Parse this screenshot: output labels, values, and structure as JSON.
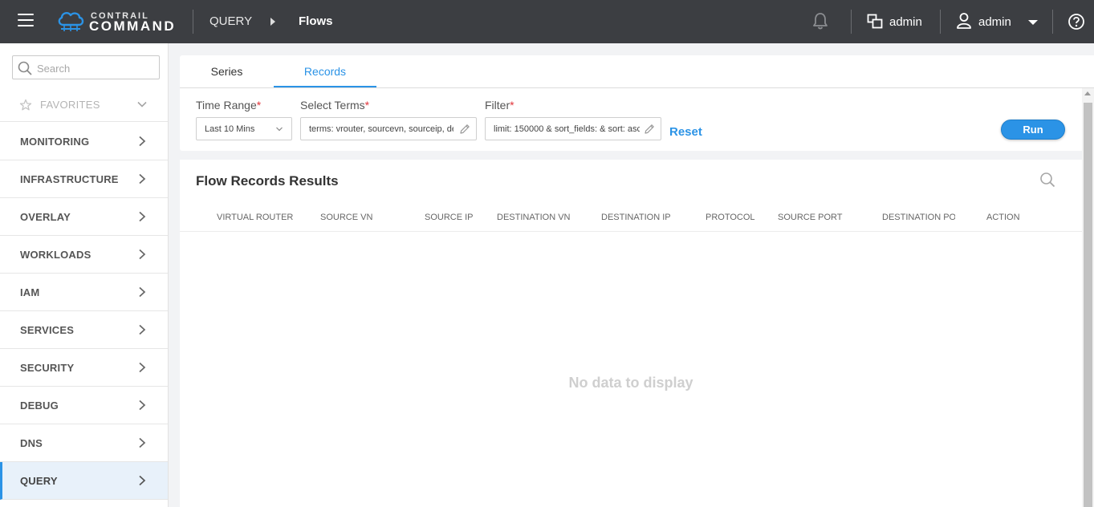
{
  "topbar": {
    "logo_top": "CONTRAIL",
    "logo_bottom": "COMMAND",
    "breadcrumb_section": "QUERY",
    "breadcrumb_page": "Flows",
    "project_label": "admin",
    "user_label": "admin"
  },
  "sidebar": {
    "search_placeholder": "Search",
    "favorites_label": "FAVORITES",
    "items": [
      {
        "label": "MONITORING"
      },
      {
        "label": "INFRASTRUCTURE"
      },
      {
        "label": "OVERLAY"
      },
      {
        "label": "WORKLOADS"
      },
      {
        "label": "IAM"
      },
      {
        "label": "SERVICES"
      },
      {
        "label": "SECURITY"
      },
      {
        "label": "DEBUG"
      },
      {
        "label": "DNS"
      },
      {
        "label": "QUERY",
        "active": true
      }
    ]
  },
  "tabs": {
    "series": "Series",
    "records": "Records",
    "active": "Records"
  },
  "form": {
    "time_range_label": "Time Range",
    "time_range_value": "Last 10 Mins",
    "select_terms_label": "Select Terms",
    "select_terms_value": "terms: vrouter, sourcevn, sourceip, destvn",
    "filter_label": "Filter",
    "filter_value": "limit: 150000 & sort_fields: & sort: asc",
    "required_mark": "*",
    "reset_label": "Reset",
    "run_label": "Run"
  },
  "results": {
    "title": "Flow Records Results",
    "columns": [
      "VIRTUAL ROUTER",
      "SOURCE VN",
      "SOURCE IP",
      "DESTINATION VN",
      "DESTINATION IP",
      "PROTOCOL",
      "SOURCE PORT",
      "DESTINATION PORT",
      "ACTION"
    ],
    "empty_text": "No data to display"
  },
  "colors": {
    "accent": "#2b93e6",
    "topbar": "#3c3e42",
    "required": "#e0343a"
  }
}
